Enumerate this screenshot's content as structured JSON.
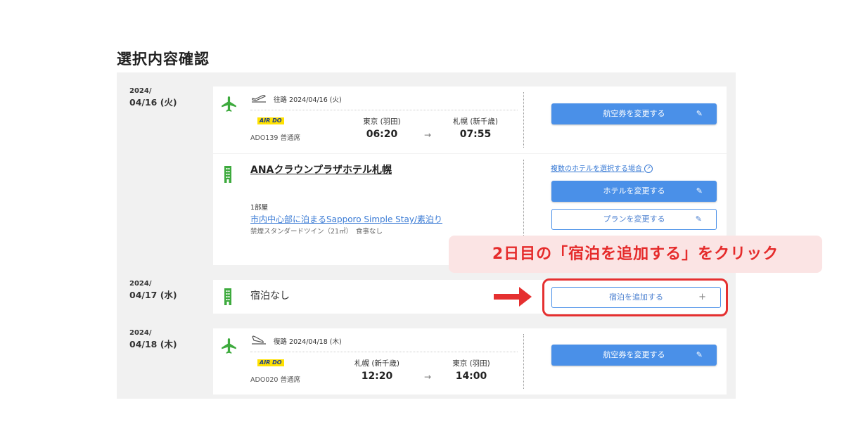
{
  "page": {
    "title": "選択内容確認"
  },
  "days": [
    {
      "year": "2024/",
      "date": "04/16 (火)"
    },
    {
      "year": "2024/",
      "date": "04/17 (水)"
    },
    {
      "year": "2024/",
      "date": "04/18 (木)"
    }
  ],
  "outbound": {
    "label": "往路 2024/04/16 (火)",
    "airline": "AIR DO",
    "flight": "ADO139  普通席",
    "from": "東京 (羽田)",
    "to": "札幌 (新千歳)",
    "dep": "06:20",
    "arr": "07:55",
    "button": "航空券を変更する"
  },
  "hotel": {
    "name": "ANAクラウンプラザホテル札幌",
    "rooms": "1部屋",
    "plan": "市内中心部に泊まるSapporo Simple Stay/素泊り",
    "room_type": "禁煙スタンダードツイン（21㎡）　食事なし",
    "multi_link": "複数のホテルを選択する場合",
    "change_hotel": "ホテルを変更する",
    "change_plan": "プランを変更する"
  },
  "day2": {
    "no_stay": "宿泊なし",
    "add_stay": "宿泊を追加する",
    "plus": "+"
  },
  "return_flight": {
    "label": "復路 2024/04/18 (木)",
    "airline": "AIR DO",
    "flight": "ADO020  普通席",
    "from": "札幌 (新千歳)",
    "to": "東京 (羽田)",
    "dep": "12:20",
    "arr": "14:00",
    "button": "航空券を変更する"
  },
  "callout": {
    "text": "2日目の「宿泊を追加する」をクリック"
  },
  "colors": {
    "accent": "#4a90e8",
    "highlight": "#e53030",
    "callout_bg": "#fbe4e4",
    "plane": "#3daa3d"
  },
  "icons": [
    "airplane-icon",
    "takeoff-icon",
    "landing-icon",
    "building-icon",
    "pencil-icon",
    "external-link-icon",
    "plus-icon",
    "arrow-right-icon"
  ]
}
